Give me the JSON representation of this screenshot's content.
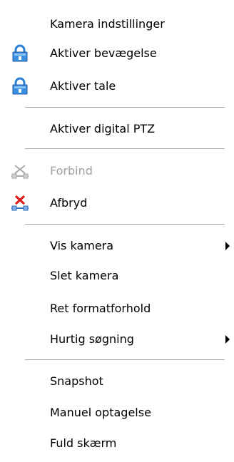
{
  "menu": {
    "items": [
      {
        "label": "Kamera indstillinger"
      },
      {
        "label": "Aktiver bevægelse",
        "icon": "padlock-icon"
      },
      {
        "label": "Aktiver tale",
        "icon": "padlock-icon"
      },
      {
        "label": "Aktiver digital PTZ"
      },
      {
        "label": "Forbind",
        "icon": "network-connect-icon",
        "disabled": true
      },
      {
        "label": "Afbryd",
        "icon": "network-disconnect-icon"
      },
      {
        "label": "Vis kamera",
        "submenu": true
      },
      {
        "label": "Slet kamera"
      },
      {
        "label": "Ret formatforhold"
      },
      {
        "label": "Hurtig søgning",
        "submenu": true
      },
      {
        "label": "Snapshot"
      },
      {
        "label": "Manuel optagelse"
      },
      {
        "label": "Fuld skærm"
      }
    ]
  },
  "colors": {
    "disabled_text": "#a0a0a0",
    "separator": "#a7a6aa",
    "padlock_blue": "#2f7fd6",
    "disconnect_red": "#e01818"
  }
}
